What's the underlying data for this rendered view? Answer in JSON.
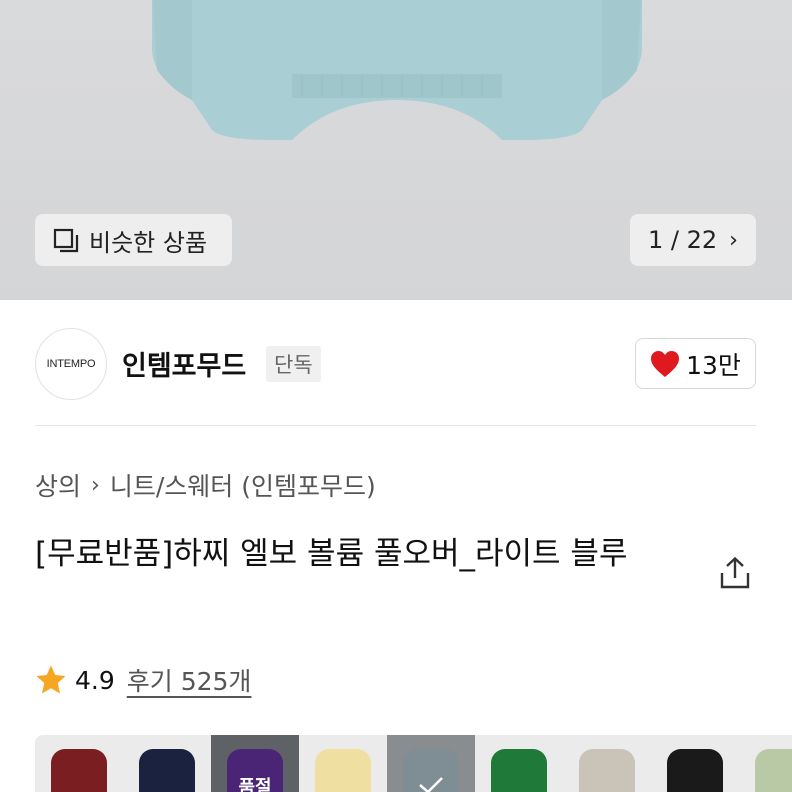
{
  "gallery": {
    "similar_label": "비슷한 상품",
    "pager": "1 / 22",
    "colors": {
      "sweater": "#a9ced3",
      "background": "#d7d8da"
    }
  },
  "brand": {
    "logo_text": "INTEMPO",
    "name": "인템포무드",
    "badge": "단독",
    "likes": "13만"
  },
  "breadcrumb": {
    "category": "상의",
    "subcategory": "니트/스웨터 (인템포무드)"
  },
  "product": {
    "title": "[무료반품]하찌 엘보 볼륨 풀오버_라이트 블루"
  },
  "rating": {
    "score": "4.9",
    "reviews": "후기 525개"
  },
  "color_options": [
    {
      "name": "burgundy",
      "color": "#7b1e22"
    },
    {
      "name": "navy",
      "color": "#1b2240"
    },
    {
      "name": "purple",
      "color": "#4a2576",
      "overlay": "품절"
    },
    {
      "name": "yellow",
      "color": "#efe0a2"
    },
    {
      "name": "grey-blue",
      "color": "#7f8d94",
      "selected": true
    },
    {
      "name": "green",
      "color": "#1f7a3a"
    },
    {
      "name": "oatmeal",
      "color": "#c9c4b7"
    },
    {
      "name": "black",
      "color": "#1a1a1a"
    },
    {
      "name": "sage",
      "color": "#b9c9a6"
    }
  ]
}
